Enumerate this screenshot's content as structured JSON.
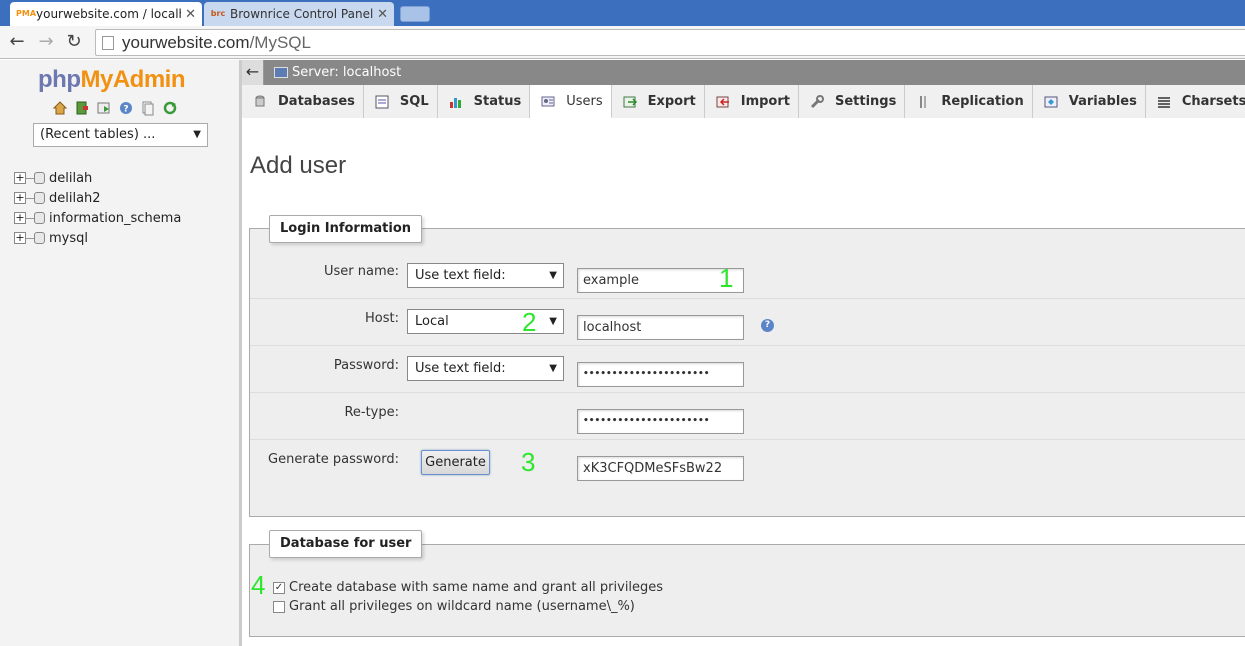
{
  "browser": {
    "tabs": [
      {
        "title": "yourwebsite.com / localhost",
        "favicon": "PMA",
        "active": true
      },
      {
        "title": "Brownrice Control Panel",
        "favicon": "brc",
        "active": false
      }
    ],
    "url_host": "yourwebsite.com",
    "url_path": "/MySQL"
  },
  "sidebar": {
    "logo_php": "php",
    "logo_my": "My",
    "logo_admin": "Admin",
    "recent_tables": "(Recent tables) ...",
    "databases": [
      "delilah",
      "delilah2",
      "information_schema",
      "mysql"
    ]
  },
  "server": {
    "label": "Server: localhost"
  },
  "tabs": [
    {
      "label": "Databases",
      "icon": "databases-icon"
    },
    {
      "label": "SQL",
      "icon": "sql-icon"
    },
    {
      "label": "Status",
      "icon": "status-icon"
    },
    {
      "label": "Users",
      "icon": "users-icon",
      "active": true
    },
    {
      "label": "Export",
      "icon": "export-icon"
    },
    {
      "label": "Import",
      "icon": "import-icon"
    },
    {
      "label": "Settings",
      "icon": "settings-icon"
    },
    {
      "label": "Replication",
      "icon": "replication-icon"
    },
    {
      "label": "Variables",
      "icon": "variables-icon"
    },
    {
      "label": "Charsets",
      "icon": "charsets-icon"
    }
  ],
  "page_title": "Add user",
  "login": {
    "legend": "Login Information",
    "username_label": "User name:",
    "username_mode": "Use text field:",
    "username_value": "example",
    "host_label": "Host:",
    "host_mode": "Local",
    "host_value": "localhost",
    "password_label": "Password:",
    "password_mode": "Use text field:",
    "password_mask": "••••••••••••••••••••••",
    "retype_label": "Re-type:",
    "retype_mask": "••••••••••••••••••••••",
    "generate_label": "Generate password:",
    "generate_button": "Generate",
    "generated_value": "xK3CFQDMeSFsBw22"
  },
  "dbuser": {
    "legend": "Database for user",
    "option1": "Create database with same name and grant all privileges",
    "option1_checked": true,
    "option2": "Grant all privileges on wildcard name (username\\_%)",
    "option2_checked": false
  },
  "annotations": [
    "1",
    "2",
    "3",
    "4"
  ],
  "colors": {
    "annotation": "#2ee62e",
    "logo_php": "#6c78af",
    "logo_myadmin": "#f29111"
  }
}
